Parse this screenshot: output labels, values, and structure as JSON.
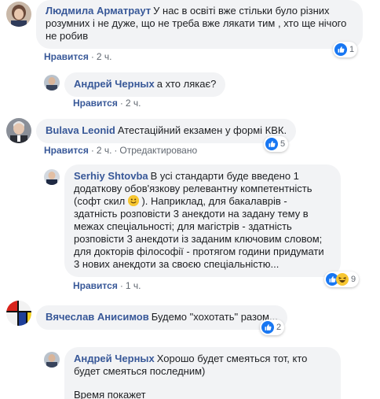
{
  "comments": [
    {
      "author": "Людмила Арматраут",
      "text": "У нас в освіті вже стільки було різних розумних і не дуже, що не треба вже лякати тим , хто ще нічого не робив",
      "like_label": "Нравится",
      "time": "2 ч.",
      "reactions": [
        "like-icon"
      ],
      "reaction_count": "1"
    },
    {
      "author": "Андрей Черных",
      "text": "а хто лякає?",
      "like_label": "Нравится",
      "time": "2 ч."
    },
    {
      "author": "Bulava Leonid",
      "text": "Атестаційний екзамен у формі КВК.",
      "like_label": "Нравится",
      "time": "2 ч.",
      "edited_label": "Отредактировано",
      "reactions": [
        "like-icon"
      ],
      "reaction_count": "5"
    },
    {
      "author": "Serhiy Shtovba",
      "text_before_emoji": "В усі стандарти буде введено 1 додаткову обов'язкову релевантну компетентність (софт скил ",
      "text_after_emoji": " ). Наприклад, для бакалаврів - здатність розповісти 3 анекдоти на задану тему в межах спеціальності; для магістрів - здатність розповісти 3 анекдоти із заданим ключовим словом; для докторів філософії - протягом години придумати 3 нових анекдоти за своєю спеціальністю...",
      "like_label": "Нравится",
      "time": "1 ч.",
      "reactions": [
        "like-icon",
        "haha-icon"
      ],
      "reaction_count": "9"
    },
    {
      "author": "Вячеслав Анисимов",
      "text": "Будемо \"хохотать\" разом...",
      "reactions": [
        "like-icon"
      ],
      "reaction_count": "2"
    },
    {
      "author": "Андрей Черных",
      "text_line1": "Хорошо будет смеяться тот, кто будет смеяться последним)",
      "text_line2": "Время покажет"
    }
  ],
  "colors": {
    "bubble": "#f2f3f5",
    "author": "#385898",
    "like_blue": "#1877f2",
    "meta_gray": "#606770"
  }
}
